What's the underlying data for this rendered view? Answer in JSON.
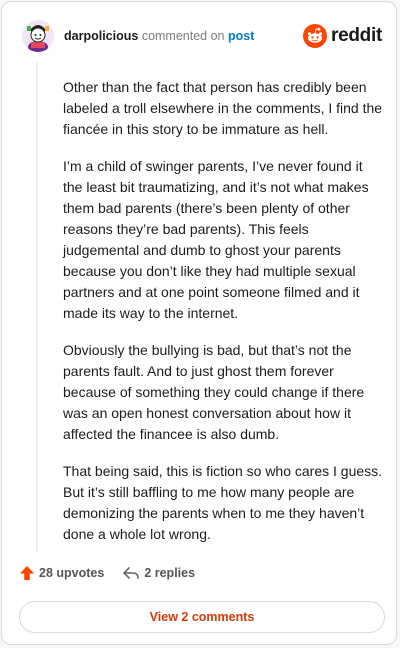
{
  "header": {
    "author": "darpolicious",
    "action_text": "commented on",
    "post_link": "post",
    "brand": "reddit"
  },
  "comment": {
    "paragraphs": [
      "Other than the fact that person has credibly been labeled a troll elsewhere in the comments, I find the fiancée in this story to be immature as hell.",
      "I’m a child of swinger parents, I’ve never found it the least bit traumatizing, and it’s not what makes them bad parents (there’s been plenty of other reasons they’re bad parents). This feels judgemental and dumb to ghost your parents because you don’t like they had multiple sexual partners and at one point someone filmed and it made its way to the internet.",
      "Obviously the bullying is bad, but that’s not the parents fault. And to just ghost them forever because of something they could change if there was an open honest conversation about how it affected the financee is also dumb.",
      "That being said, this is fiction so who cares I guess. But it’s still baffling to me how many people are demonizing the parents when to me they haven’t done a whole lot wrong."
    ]
  },
  "actions": {
    "upvotes": "28 upvotes",
    "replies": "2 replies",
    "view_comments": "View 2 comments"
  },
  "icons": {
    "upvote": "upvote-arrow-icon",
    "reply": "reply-arrow-icon",
    "brand_logo": "reddit-snoo-icon"
  },
  "colors": {
    "upvote": "#ff4500",
    "link": "#0079d3",
    "view_button_text": "#d93a00",
    "brand": "#ff4500"
  }
}
